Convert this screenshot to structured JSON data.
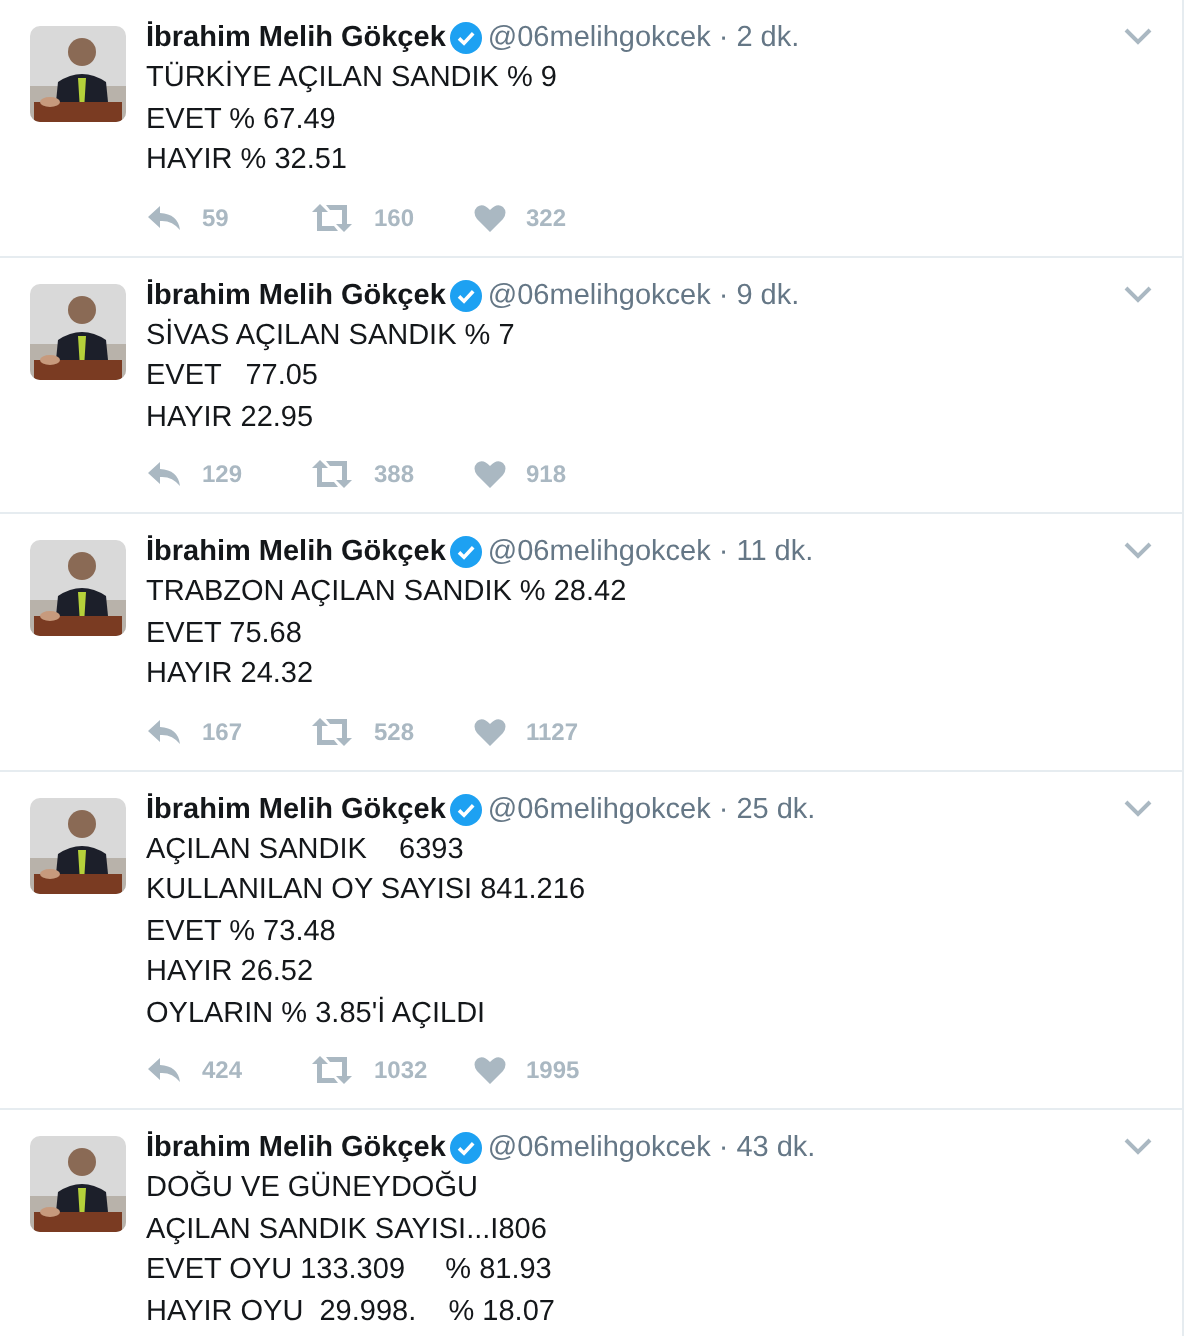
{
  "tweets": [
    {
      "name": "İbrahim Melih Gökçek",
      "verified": true,
      "handle": "@06melihgokcek",
      "time": "· 2 dk.",
      "lines": [
        "TÜRKİYE AÇILAN SANDIK % 9",
        "EVET % 67.49",
        "HAYIR % 32.51"
      ],
      "replies": "59",
      "retweets": "160",
      "likes": "322"
    },
    {
      "name": "İbrahim Melih Gökçek",
      "verified": true,
      "handle": "@06melihgokcek",
      "time": "· 9 dk.",
      "lines": [
        "SİVAS AÇILAN SANDIK % 7",
        "EVET   77.05",
        "HAYIR 22.95"
      ],
      "replies": "129",
      "retweets": "388",
      "likes": "918"
    },
    {
      "name": "İbrahim Melih Gökçek",
      "verified": true,
      "handle": "@06melihgokcek",
      "time": "· 11 dk.",
      "lines": [
        "TRABZON AÇILAN SANDIK % 28.42",
        "EVET 75.68",
        "HAYIR 24.32"
      ],
      "replies": "167",
      "retweets": "528",
      "likes": "1127"
    },
    {
      "name": "İbrahim Melih Gökçek",
      "verified": true,
      "handle": "@06melihgokcek",
      "time": "· 25 dk.",
      "lines": [
        "AÇILAN SANDIK    6393",
        "KULLANILAN OY SAYISI 841.216",
        "EVET % 73.48",
        "HAYIR 26.52",
        "OYLARIN % 3.85'İ AÇILDI"
      ],
      "replies": "424",
      "retweets": "1032",
      "likes": "1995"
    },
    {
      "name": "İbrahim Melih Gökçek",
      "verified": true,
      "handle": "@06melihgokcek",
      "time": "· 43 dk.",
      "lines": [
        "DOĞU VE GÜNEYDOĞU",
        "AÇILAN SANDIK SAYISI...I806",
        "EVET OYU 133.309     % 81.93",
        "HAYIR OYU  29.998.    % 18.07"
      ]
    }
  ]
}
